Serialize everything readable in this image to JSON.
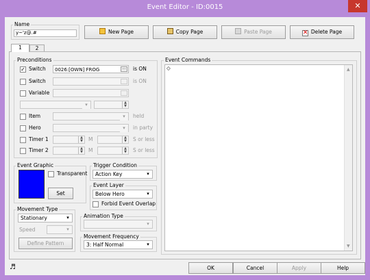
{
  "window": {
    "title": "Event Editor - ID:0015",
    "close_glyph": "✕"
  },
  "name": {
    "label": "Name",
    "value": "y~'z@.#"
  },
  "toolbar": {
    "new_page": "New Page",
    "copy_page": "Copy Page",
    "paste_page": "Paste Page",
    "delete_page": "Delete Page"
  },
  "tabs": [
    "1",
    "2"
  ],
  "preconditions": {
    "label": "Preconditions",
    "switch1": {
      "label": "Switch",
      "checked": true,
      "value": "0026:[OWN] FROG",
      "suffix": "is ON",
      "button": "..."
    },
    "switch2": {
      "label": "Switch",
      "checked": false,
      "suffix": "is ON"
    },
    "variable": {
      "label": "Variable",
      "checked": false
    },
    "item": {
      "label": "Item",
      "checked": false,
      "suffix": "held"
    },
    "hero": {
      "label": "Hero",
      "checked": false,
      "suffix": "in party"
    },
    "timer1": {
      "label": "Timer 1",
      "checked": false,
      "unit_m": "M",
      "suffix": "S or less"
    },
    "timer2": {
      "label": "Timer 2",
      "checked": false,
      "unit_m": "M",
      "suffix": "S or less"
    }
  },
  "event_graphic": {
    "label": "Event Graphic",
    "transparent_label": "Transparent",
    "set_button": "Set",
    "color": "#0000ff"
  },
  "trigger": {
    "label": "Trigger Condition",
    "value": "Action Key"
  },
  "event_layer": {
    "label": "Event Layer",
    "value": "Below Hero",
    "forbid_overlap_label": "Forbid Event Overlap"
  },
  "movement_type": {
    "label": "Movement Type",
    "value": "Stationary",
    "speed_label": "Speed",
    "define_pattern": "Define Pattern"
  },
  "animation_type": {
    "label": "Animation Type"
  },
  "movement_frequency": {
    "label": "Movement Frequency",
    "value": "3: Half Normal"
  },
  "event_commands": {
    "label": "Event Commands",
    "first_line": "◇"
  },
  "footer": {
    "music_icon": "♬",
    "ok": "OK",
    "cancel": "Cancel",
    "apply": "Apply",
    "help": "Help"
  },
  "colors": {
    "frame": "#b78ad9",
    "client": "#f0f0f0",
    "close": "#c7372d",
    "graphic": "#0000ff"
  }
}
